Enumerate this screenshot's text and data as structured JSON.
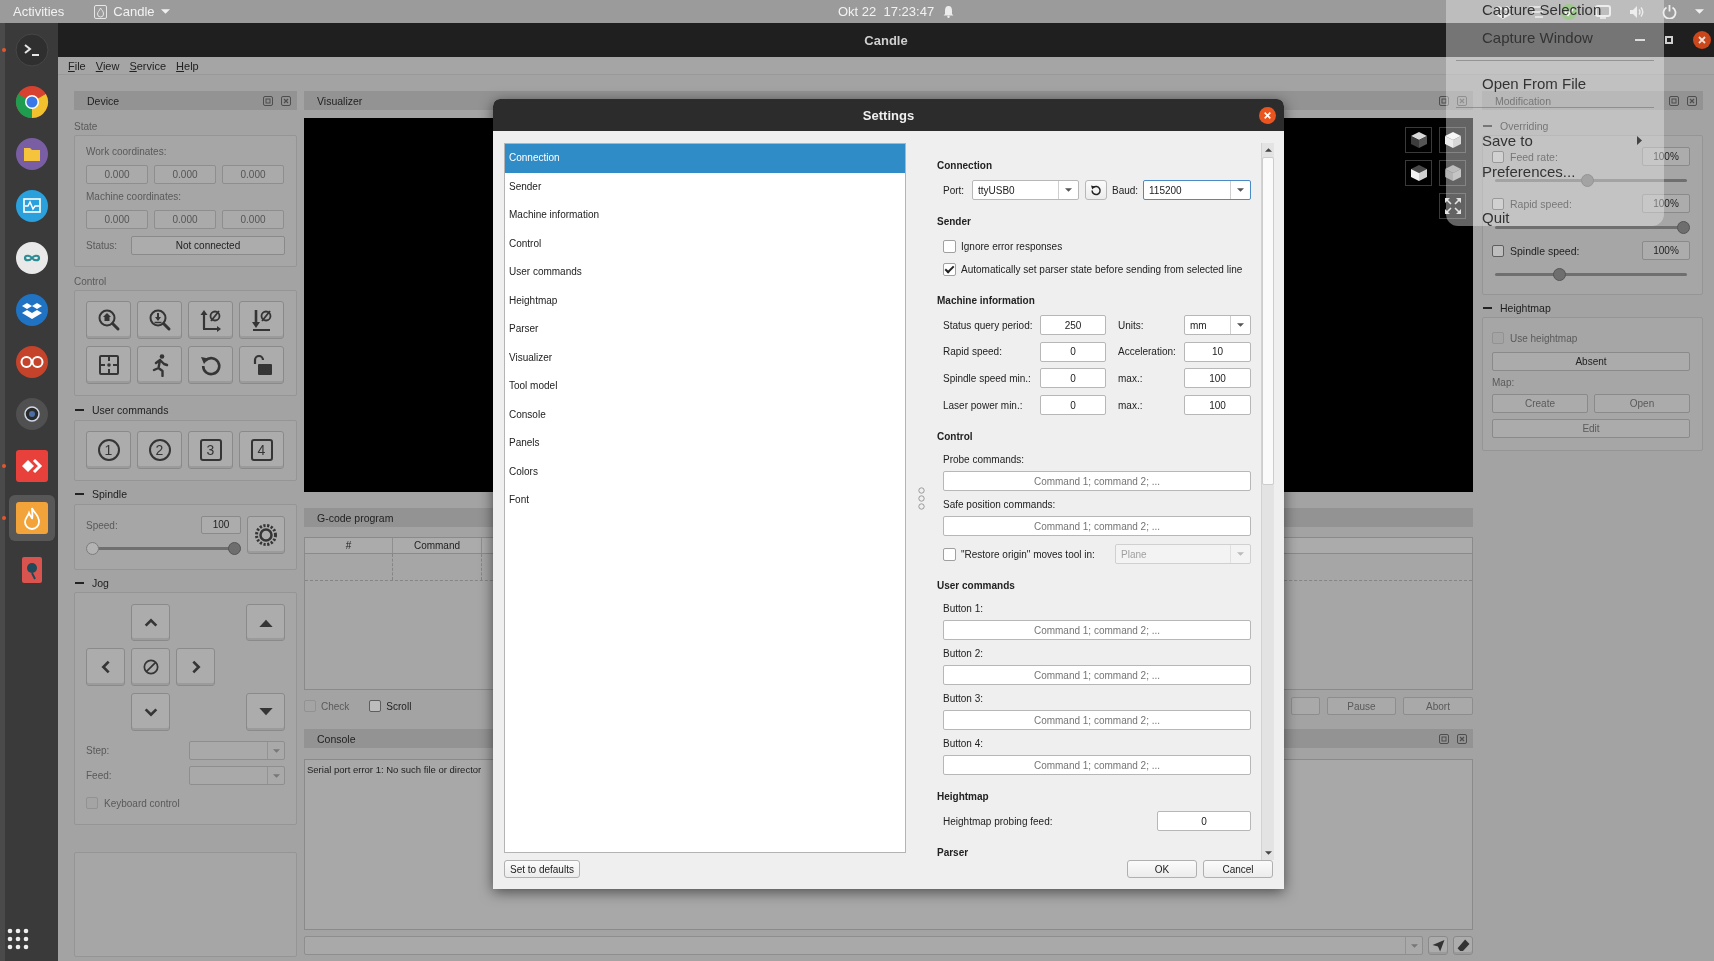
{
  "top_bar": {
    "activities": "Activities",
    "app_menu": "Candle",
    "clock": "Okt 22  17:23:47"
  },
  "dock": [
    {
      "kind": "terminal",
      "running": true,
      "selected": false
    },
    {
      "kind": "browser",
      "running": false,
      "selected": false
    },
    {
      "kind": "files",
      "running": false,
      "selected": false
    },
    {
      "kind": "monitor",
      "running": false,
      "selected": false
    },
    {
      "kind": "infinity",
      "running": false,
      "selected": false
    },
    {
      "kind": "box",
      "running": false,
      "selected": false
    },
    {
      "kind": "rings",
      "running": false,
      "selected": false
    },
    {
      "kind": "lens",
      "running": false,
      "selected": false
    },
    {
      "kind": "remote",
      "running": true,
      "selected": false
    },
    {
      "kind": "flame",
      "running": true,
      "selected": true
    },
    {
      "kind": "pin",
      "running": false,
      "selected": false
    }
  ],
  "window": {
    "title": "Candle",
    "menu": [
      "File",
      "View",
      "Service",
      "Help"
    ]
  },
  "device_panel": {
    "title": "Device",
    "state": {
      "title": "State",
      "work_label": "Work coordinates:",
      "work": [
        "0.000",
        "0.000",
        "0.000"
      ],
      "machine_label": "Machine coordinates:",
      "machine": [
        "0.000",
        "0.000",
        "0.000"
      ],
      "status_label": "Status:",
      "status": "Not connected"
    },
    "control": {
      "title": "Control"
    },
    "user_commands": {
      "title": "User commands",
      "buttons": [
        {
          "label": "1",
          "kind": "circle"
        },
        {
          "label": "2",
          "kind": "circle"
        },
        {
          "label": "3",
          "kind": "square"
        },
        {
          "label": "4",
          "kind": "square"
        }
      ]
    },
    "spindle": {
      "title": "Spindle",
      "speed_label": "Speed:",
      "speed": "100",
      "thumbs": [
        {
          "kind": "light",
          "level": 0
        },
        {
          "kind": "dark",
          "level": 1
        }
      ]
    },
    "jog": {
      "title": "Jog",
      "step_label": "Step:",
      "feed_label": "Feed:",
      "keyboard": {
        "label": "Keyboard control",
        "checked": false,
        "disabled": true
      }
    }
  },
  "visualizer": {
    "title": "Visualizer"
  },
  "gcode": {
    "title": "G-code program",
    "columns": [
      "#",
      "Command"
    ],
    "options": [
      {
        "label": "Check",
        "checked": false,
        "disabled": true
      },
      {
        "label": "Scroll",
        "checked": false,
        "disabled": false
      }
    ],
    "buttons": [
      {
        "label": "Pause",
        "disabled": true
      },
      {
        "label": "Abort",
        "disabled": true
      }
    ]
  },
  "console": {
    "title": "Console",
    "lines": [
      "Serial port error 1: No such file or director"
    ]
  },
  "modification": {
    "title": "Modification",
    "overriding": {
      "title": "Overriding",
      "rows": [
        {
          "label": "Feed rate:",
          "checked": false,
          "value": "100%",
          "level": 0.48
        },
        {
          "label": "Rapid speed:",
          "checked": false,
          "value": "100%",
          "level": 1
        },
        {
          "label": "Spindle speed:",
          "checked": false,
          "value": "100%",
          "level": 0.33
        }
      ]
    },
    "heightmap": {
      "title": "Heightmap",
      "use": {
        "label": "Use heightmap",
        "checked": false,
        "disabled": true
      },
      "status": "Absent",
      "map_label": "Map:",
      "buttons": [
        {
          "label": "Create",
          "disabled": true
        },
        {
          "label": "Open",
          "disabled": true
        }
      ],
      "edit": {
        "label": "Edit",
        "disabled": true
      }
    }
  },
  "settings_dialog": {
    "title": "Settings",
    "nav": [
      {
        "label": "Connection",
        "selected": true
      },
      {
        "label": "Sender",
        "selected": false
      },
      {
        "label": "Machine information",
        "selected": false
      },
      {
        "label": "Control",
        "selected": false
      },
      {
        "label": "User commands",
        "selected": false
      },
      {
        "label": "Heightmap",
        "selected": false
      },
      {
        "label": "Parser",
        "selected": false
      },
      {
        "label": "Visualizer",
        "selected": false
      },
      {
        "label": "Tool model",
        "selected": false
      },
      {
        "label": "Console",
        "selected": false
      },
      {
        "label": "Panels",
        "selected": false
      },
      {
        "label": "Colors",
        "selected": false
      },
      {
        "label": "Font",
        "selected": false
      }
    ],
    "sections": [
      {
        "title": "Connection",
        "items": [
          {
            "kind": "port",
            "fields": [
              {
                "label": "Port:",
                "value": "ttyUSB0",
                "focused": false
              },
              {
                "label": "Baud:",
                "value": "115200",
                "focused": true
              }
            ]
          }
        ]
      },
      {
        "title": "Sender",
        "items": [
          {
            "kind": "checkbox",
            "label": "Ignore error responses",
            "checked": false
          },
          {
            "kind": "checkbox",
            "label": "Automatically set parser state before sending from selected line",
            "checked": true
          }
        ]
      },
      {
        "title": "Machine information",
        "items": [
          {
            "kind": "pair",
            "cells": [
              {
                "kind": "field",
                "label": "Status query period:",
                "value": "250"
              },
              {
                "kind": "combo",
                "label": "Units:",
                "value": "mm"
              }
            ]
          },
          {
            "kind": "pair",
            "cells": [
              {
                "kind": "field",
                "label": "Rapid speed:",
                "value": "0"
              },
              {
                "kind": "field",
                "label": "Acceleration:",
                "value": "10"
              }
            ]
          },
          {
            "kind": "pair",
            "cells": [
              {
                "kind": "field",
                "label": "Spindle speed min.:",
                "value": "0"
              },
              {
                "kind": "field",
                "label": "max.:",
                "value": "100"
              }
            ]
          },
          {
            "kind": "pair",
            "cells": [
              {
                "kind": "field",
                "label": "Laser power min.:",
                "value": "0"
              },
              {
                "kind": "field",
                "label": "max.:",
                "value": "100"
              }
            ]
          }
        ]
      },
      {
        "title": "Control",
        "items": [
          {
            "kind": "text",
            "label": "Probe commands:",
            "placeholder": "Command 1; command 2; ..."
          },
          {
            "kind": "text",
            "label": "Safe position commands:",
            "placeholder": "Command 1; command 2; ..."
          },
          {
            "kind": "check_combo",
            "label": "\"Restore origin\" moves tool in:",
            "checked": false,
            "value": "Plane",
            "disabled": true
          }
        ]
      },
      {
        "title": "User commands",
        "items": [
          {
            "kind": "text",
            "label": "Button 1:",
            "placeholder": "Command 1; command 2; ..."
          },
          {
            "kind": "text",
            "label": "Button 2:",
            "placeholder": "Command 1; command 2; ..."
          },
          {
            "kind": "text",
            "label": "Button 3:",
            "placeholder": "Command 1; command 2; ..."
          },
          {
            "kind": "text",
            "label": "Button 4:",
            "placeholder": "Command 1; command 2; ..."
          }
        ]
      },
      {
        "title": "Heightmap",
        "items": [
          {
            "kind": "inline",
            "label": "Heightmap probing feed:",
            "value": "0"
          }
        ]
      },
      {
        "title": "Parser"
      }
    ],
    "defaults_button": "Set to defaults",
    "buttons": [
      "OK",
      "Cancel"
    ]
  },
  "capture_menu": {
    "items": [
      {
        "kind": "item",
        "label": "Capture Selection"
      },
      {
        "kind": "item",
        "label": "Capture Window"
      },
      {
        "kind": "separator"
      },
      {
        "kind": "item",
        "label": "Open From File"
      },
      {
        "kind": "separator"
      },
      {
        "kind": "submenu",
        "label": "Save to"
      },
      {
        "kind": "item",
        "label": "Preferences..."
      },
      {
        "kind": "item",
        "label": "Quit"
      }
    ]
  }
}
